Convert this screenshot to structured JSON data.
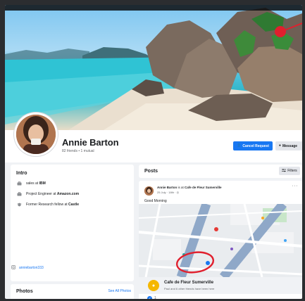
{
  "profile": {
    "name": "Annie Barton",
    "friends": "82 friends • 1 mutual",
    "cancel_request_label": "Cancel Request",
    "message_label": "Message"
  },
  "intro": {
    "title": "Intro",
    "items": [
      {
        "icon": "briefcase-icon",
        "prefix": "sales at ",
        "bold": "IBM"
      },
      {
        "icon": "briefcase-icon",
        "prefix": "Project Engineer at ",
        "bold": "Amazon.com"
      },
      {
        "icon": "graduation-cap-icon",
        "prefix": "Former Research fellow at ",
        "bold": "Castle"
      }
    ],
    "instagram": "anniebarton333"
  },
  "photos": {
    "title": "Photos",
    "see_all": "See All Photos"
  },
  "posts": {
    "title": "Posts",
    "filters_label": "Filters"
  },
  "post": {
    "author": "Annie Barton",
    "connector": " is at ",
    "place": "Cafe de Fleur Sumerville",
    "meta": "25 July · 18th · ◎",
    "text": "Good Morning",
    "place_name": "Cafe de Fleur Sumerville",
    "place_sub": "Paul and 6 other friends have been here",
    "reaction_count": "1"
  },
  "colors": {
    "accent": "#1877f2",
    "annotation": "#e0202e"
  }
}
